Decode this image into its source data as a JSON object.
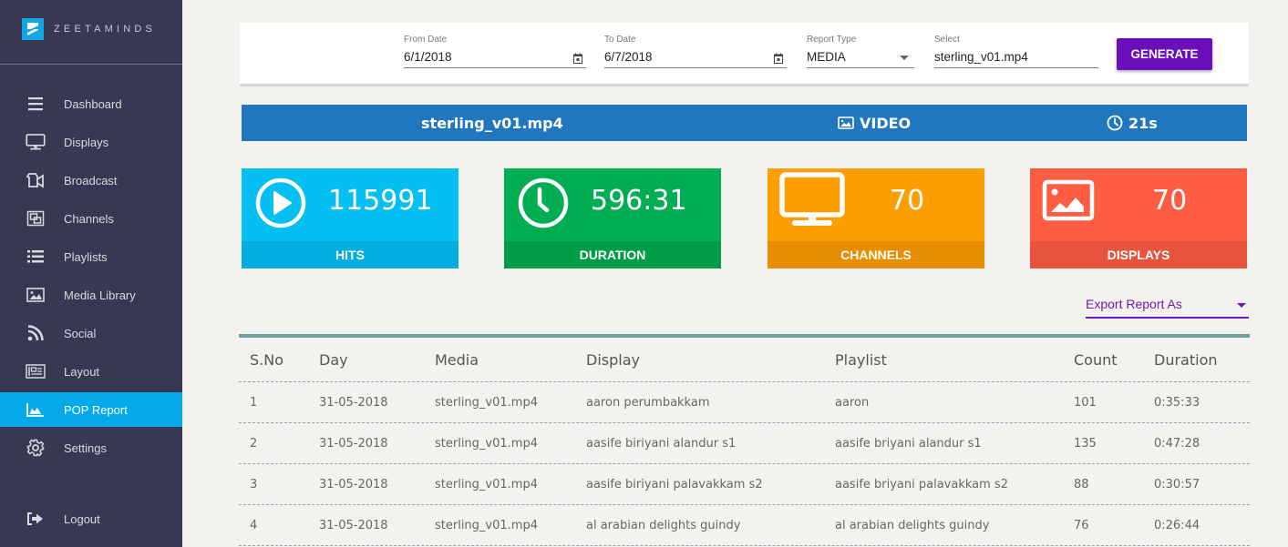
{
  "brand": {
    "name": "ZEETAMINDS",
    "color": "#14a6e2"
  },
  "sidebar": {
    "items": [
      {
        "label": "Dashboard",
        "icon": "menu-icon",
        "active": false
      },
      {
        "label": "Displays",
        "icon": "monitor-icon",
        "active": false
      },
      {
        "label": "Broadcast",
        "icon": "video-camera-icon",
        "active": false
      },
      {
        "label": "Channels",
        "icon": "channels-icon",
        "active": false
      },
      {
        "label": "Playlists",
        "icon": "list-icon",
        "active": false
      },
      {
        "label": "Media Library",
        "icon": "image-icon",
        "active": false
      },
      {
        "label": "Social",
        "icon": "rss-icon",
        "active": false
      },
      {
        "label": "Layout",
        "icon": "layout-icon",
        "active": false
      },
      {
        "label": "POP Report",
        "icon": "area-chart-icon",
        "active": true
      },
      {
        "label": "Settings",
        "icon": "gear-icon",
        "active": false
      }
    ],
    "logout": {
      "label": "Logout",
      "icon": "logout-icon"
    },
    "colors": {
      "background": "#393852",
      "active": "#03a9e8"
    }
  },
  "filters": {
    "from_date": {
      "label": "From Date",
      "value": "6/1/2018"
    },
    "to_date": {
      "label": "To Date",
      "value": "6/7/2018"
    },
    "report_type": {
      "label": "Report Type",
      "value": "MEDIA"
    },
    "select": {
      "label": "Select",
      "value": "sterling_v01.mp4"
    },
    "generate_label": "GENERATE",
    "generate_color": "#6b0fbd"
  },
  "info_bar": {
    "media_name": "sterling_v01.mp4",
    "media_type": "VIDEO",
    "duration": "21s",
    "color": "#2077bf"
  },
  "stats": [
    {
      "label": "HITS",
      "value": "115991",
      "icon": "play-circle-icon",
      "color": "#03bff2",
      "footer_color": "#02ade0"
    },
    {
      "label": "DURATION",
      "value": "596:31",
      "icon": "clock-icon",
      "color": "#00ad52",
      "footer_color": "#009c48"
    },
    {
      "label": "CHANNELS",
      "value": "70",
      "icon": "monitor-icon",
      "color": "#fd9e03",
      "footer_color": "#e68d00"
    },
    {
      "label": "DISPLAYS",
      "value": "70",
      "icon": "image-icon",
      "color": "#ff5c44",
      "footer_color": "#e8533d"
    }
  ],
  "export": {
    "label": "Export Report As"
  },
  "table": {
    "columns": [
      "S.No",
      "Day",
      "Media",
      "Display",
      "Playlist",
      "Count",
      "Duration"
    ],
    "rows": [
      [
        "1",
        "31-05-2018",
        "sterling_v01.mp4",
        "aaron perumbakkam",
        "aaron",
        "101",
        "0:35:33"
      ],
      [
        "2",
        "31-05-2018",
        "sterling_v01.mp4",
        "aasife biriyani alandur s1",
        "aasife briyani alandur s1",
        "135",
        "0:47:28"
      ],
      [
        "3",
        "31-05-2018",
        "sterling_v01.mp4",
        "aasife biriyani palavakkam s2",
        "aasife briyani palavakkam s2",
        "88",
        "0:30:57"
      ],
      [
        "4",
        "31-05-2018",
        "sterling_v01.mp4",
        "al arabian delights guindy",
        "al arabian delights guindy",
        "76",
        "0:26:44"
      ]
    ]
  }
}
